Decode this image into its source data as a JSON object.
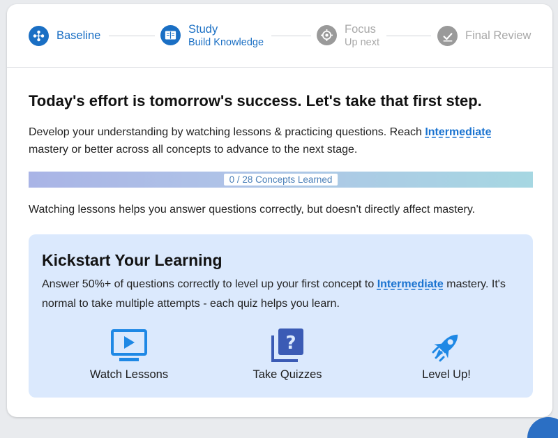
{
  "stepper": {
    "steps": [
      {
        "label": "Baseline",
        "sub": "",
        "icon": "baseline-icon",
        "state": "active"
      },
      {
        "label": "Study",
        "sub": "Build Knowledge",
        "icon": "book-icon",
        "state": "active"
      },
      {
        "label": "Focus",
        "sub": "Up next",
        "icon": "target-icon",
        "state": "inactive"
      },
      {
        "label": "Final Review",
        "sub": "",
        "icon": "check-stamp-icon",
        "state": "inactive"
      }
    ]
  },
  "main": {
    "headline": "Today's effort is tomorrow's success. Let's take that first step.",
    "desc_part1": "Develop your understanding by watching lessons & practicing questions. Reach ",
    "desc_link": "Intermediate",
    "desc_part2": " mastery or better across all concepts to advance to the next stage.",
    "progress": {
      "label": "0 / 28 Concepts Learned",
      "learned": 0,
      "total": 28,
      "fraction": 0
    },
    "note": "Watching lessons helps you answer questions correctly, but doesn't directly affect mastery."
  },
  "kickstart": {
    "title": "Kickstart Your Learning",
    "desc_part1": "Answer 50%+ of questions correctly to level up your first concept to ",
    "desc_link": "Intermediate",
    "desc_part2": " mastery. It's normal to take multiple attempts - each quiz helps you learn.",
    "features": [
      {
        "label": "Watch Lessons",
        "icon": "video-lesson-icon"
      },
      {
        "label": "Take Quizzes",
        "icon": "quiz-question-icon"
      },
      {
        "label": "Level Up!",
        "icon": "rocket-icon"
      }
    ]
  },
  "colors": {
    "accent": "#1a6fc4",
    "link": "#1a73d0",
    "inactive": "#a8a8a8",
    "panel_bg": "#dbe9fd",
    "icon_blue": "#1e88e5",
    "quiz_icon": "#3b5bb5"
  }
}
